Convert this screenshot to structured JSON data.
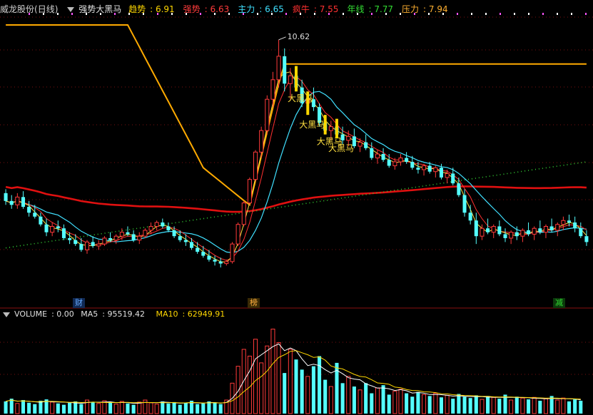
{
  "header": {
    "stock_name": "威龙股份",
    "period": "(日线)",
    "indicator_name": "强势大黑马",
    "items": [
      {
        "label": "趋势",
        "value": "6.91",
        "color": "#ffd700"
      },
      {
        "label": "强势",
        "value": "6.63",
        "color": "#ff3b3b"
      },
      {
        "label": "主力",
        "value": "6.65",
        "color": "#3fe0ff"
      },
      {
        "label": "疯牛",
        "value": "7.55",
        "color": "#ff3030"
      },
      {
        "label": "年线",
        "value": "7.77",
        "color": "#33dd33"
      },
      {
        "label": "压力",
        "value": "7.94",
        "color": "#ffb030"
      }
    ]
  },
  "volume_header": {
    "label": "VOLUME",
    "value": "0.00",
    "ma5_label": "MA5",
    "ma5_value": "95519.42",
    "ma10_label": "MA10",
    "ma10_value": "62949.91"
  },
  "markers": [
    {
      "text": "财",
      "color": "#66aaff",
      "bg": "#102a55"
    },
    {
      "text": "榜",
      "color": "#ffb040",
      "bg": "#3a2a05"
    },
    {
      "text": "减",
      "color": "#33dd33",
      "bg": "#0b3a0b"
    }
  ],
  "chart_data": {
    "type": "candlestick",
    "signal_label": "大黑马",
    "high_label": "10.62",
    "high_value": 10.62,
    "price_range": [
      4.2,
      11.2
    ],
    "signals_at": [
      50,
      52,
      55,
      57
    ],
    "ohlc": [
      [
        6.7,
        6.8,
        6.4,
        6.5
      ],
      [
        6.5,
        6.65,
        6.3,
        6.4
      ],
      [
        6.4,
        6.7,
        6.3,
        6.6
      ],
      [
        6.6,
        6.75,
        6.3,
        6.35
      ],
      [
        6.35,
        6.5,
        6.1,
        6.2
      ],
      [
        6.2,
        6.4,
        6.05,
        6.1
      ],
      [
        6.1,
        6.2,
        5.85,
        5.9
      ],
      [
        5.9,
        6.05,
        5.6,
        5.7
      ],
      [
        5.7,
        5.95,
        5.6,
        5.85
      ],
      [
        5.85,
        6.0,
        5.7,
        5.8
      ],
      [
        5.8,
        5.9,
        5.5,
        5.55
      ],
      [
        5.55,
        5.7,
        5.4,
        5.5
      ],
      [
        5.5,
        5.65,
        5.35,
        5.4
      ],
      [
        5.4,
        5.55,
        5.2,
        5.25
      ],
      [
        5.25,
        5.5,
        5.15,
        5.45
      ],
      [
        5.45,
        5.6,
        5.3,
        5.35
      ],
      [
        5.35,
        5.5,
        5.25,
        5.4
      ],
      [
        5.4,
        5.6,
        5.35,
        5.55
      ],
      [
        5.55,
        5.7,
        5.45,
        5.5
      ],
      [
        5.5,
        5.65,
        5.4,
        5.6
      ],
      [
        5.6,
        5.8,
        5.5,
        5.7
      ],
      [
        5.7,
        5.85,
        5.6,
        5.65
      ],
      [
        5.65,
        5.75,
        5.45,
        5.5
      ],
      [
        5.5,
        5.7,
        5.4,
        5.6
      ],
      [
        5.6,
        5.8,
        5.55,
        5.75
      ],
      [
        5.75,
        5.95,
        5.65,
        5.85
      ],
      [
        5.85,
        6.0,
        5.75,
        5.95
      ],
      [
        5.95,
        6.05,
        5.8,
        5.85
      ],
      [
        5.85,
        5.95,
        5.7,
        5.75
      ],
      [
        5.75,
        5.85,
        5.55,
        5.6
      ],
      [
        5.6,
        5.75,
        5.45,
        5.5
      ],
      [
        5.5,
        5.65,
        5.35,
        5.45
      ],
      [
        5.45,
        5.55,
        5.25,
        5.3
      ],
      [
        5.3,
        5.45,
        5.15,
        5.2
      ],
      [
        5.2,
        5.35,
        5.05,
        5.1
      ],
      [
        5.1,
        5.25,
        4.95,
        5.0
      ],
      [
        5.0,
        5.1,
        4.85,
        4.95
      ],
      [
        4.95,
        5.05,
        4.8,
        4.9
      ],
      [
        4.9,
        5.0,
        4.85,
        4.95
      ],
      [
        4.95,
        5.45,
        4.9,
        5.4
      ],
      [
        5.4,
        5.95,
        5.35,
        5.9
      ],
      [
        5.9,
        6.5,
        5.85,
        6.45
      ],
      [
        6.45,
        7.1,
        6.4,
        7.05
      ],
      [
        7.05,
        7.8,
        7.0,
        7.75
      ],
      [
        7.75,
        8.4,
        7.6,
        8.3
      ],
      [
        8.3,
        9.2,
        8.2,
        9.1
      ],
      [
        9.1,
        9.8,
        8.9,
        9.6
      ],
      [
        9.6,
        10.62,
        9.4,
        10.2
      ],
      [
        10.2,
        10.4,
        9.3,
        9.5
      ],
      [
        9.5,
        9.9,
        9.1,
        9.7
      ],
      [
        9.7,
        9.95,
        9.3,
        9.4
      ],
      [
        9.4,
        9.6,
        8.9,
        9.0
      ],
      [
        9.0,
        9.3,
        8.7,
        9.1
      ],
      [
        9.1,
        9.4,
        8.8,
        8.9
      ],
      [
        8.9,
        9.0,
        8.4,
        8.5
      ],
      [
        8.5,
        8.7,
        8.2,
        8.3
      ],
      [
        8.3,
        8.55,
        8.05,
        8.4
      ],
      [
        8.4,
        8.6,
        8.1,
        8.2
      ],
      [
        8.2,
        8.4,
        7.95,
        8.05
      ],
      [
        8.05,
        8.3,
        7.9,
        8.15
      ],
      [
        8.15,
        8.35,
        7.85,
        7.9
      ],
      [
        7.9,
        8.1,
        7.75,
        8.0
      ],
      [
        8.0,
        8.2,
        7.8,
        7.85
      ],
      [
        7.85,
        8.0,
        7.55,
        7.6
      ],
      [
        7.6,
        7.8,
        7.45,
        7.7
      ],
      [
        7.7,
        7.85,
        7.5,
        7.55
      ],
      [
        7.55,
        7.7,
        7.35,
        7.4
      ],
      [
        7.4,
        7.6,
        7.3,
        7.5
      ],
      [
        7.5,
        7.7,
        7.4,
        7.6
      ],
      [
        7.6,
        7.75,
        7.45,
        7.5
      ],
      [
        7.5,
        7.65,
        7.3,
        7.35
      ],
      [
        7.35,
        7.5,
        7.2,
        7.3
      ],
      [
        7.3,
        7.45,
        7.15,
        7.4
      ],
      [
        7.4,
        7.5,
        7.2,
        7.25
      ],
      [
        7.25,
        7.4,
        7.1,
        7.35
      ],
      [
        7.35,
        7.45,
        7.05,
        7.1
      ],
      [
        7.1,
        7.3,
        6.95,
        7.2
      ],
      [
        7.2,
        7.35,
        6.9,
        6.95
      ],
      [
        6.95,
        7.1,
        6.6,
        6.65
      ],
      [
        6.65,
        6.8,
        6.1,
        6.2
      ],
      [
        6.2,
        6.4,
        5.9,
        6.0
      ],
      [
        6.0,
        6.2,
        5.4,
        5.6
      ],
      [
        5.6,
        5.9,
        5.5,
        5.8
      ],
      [
        5.8,
        6.05,
        5.65,
        5.7
      ],
      [
        5.7,
        5.9,
        5.55,
        5.85
      ],
      [
        5.85,
        6.0,
        5.6,
        5.65
      ],
      [
        5.65,
        5.8,
        5.45,
        5.55
      ],
      [
        5.55,
        5.75,
        5.4,
        5.7
      ],
      [
        5.7,
        5.85,
        5.5,
        5.6
      ],
      [
        5.6,
        5.8,
        5.45,
        5.75
      ],
      [
        5.75,
        5.95,
        5.6,
        5.65
      ],
      [
        5.65,
        5.85,
        5.5,
        5.8
      ],
      [
        5.8,
        6.0,
        5.65,
        5.7
      ],
      [
        5.7,
        5.9,
        5.55,
        5.85
      ],
      [
        5.85,
        6.05,
        5.7,
        5.75
      ],
      [
        5.75,
        5.95,
        5.6,
        5.9
      ],
      [
        5.9,
        6.1,
        5.75,
        6.0
      ],
      [
        6.0,
        6.15,
        5.85,
        5.95
      ],
      [
        5.95,
        6.1,
        5.7,
        5.8
      ],
      [
        5.8,
        5.95,
        5.55,
        5.6
      ],
      [
        5.6,
        5.75,
        5.35,
        5.45
      ]
    ],
    "volume": [
      18,
      22,
      15,
      20,
      16,
      14,
      19,
      21,
      17,
      15,
      13,
      16,
      18,
      14,
      20,
      17,
      15,
      19,
      16,
      14,
      18,
      15,
      13,
      17,
      20,
      16,
      14,
      18,
      15,
      17,
      13,
      16,
      19,
      14,
      15,
      18,
      16,
      14,
      20,
      45,
      70,
      95,
      85,
      110,
      75,
      100,
      125,
      105,
      60,
      95,
      80,
      65,
      55,
      70,
      85,
      50,
      40,
      75,
      45,
      55,
      40,
      35,
      45,
      30,
      38,
      42,
      28,
      33,
      36,
      30,
      25,
      32,
      28,
      26,
      30,
      24,
      27,
      22,
      29,
      25,
      23,
      27,
      21,
      26,
      24,
      22,
      28,
      20,
      25,
      23,
      21,
      24,
      19,
      22,
      26,
      20,
      23,
      18,
      21,
      19
    ],
    "volume_max": 135
  }
}
